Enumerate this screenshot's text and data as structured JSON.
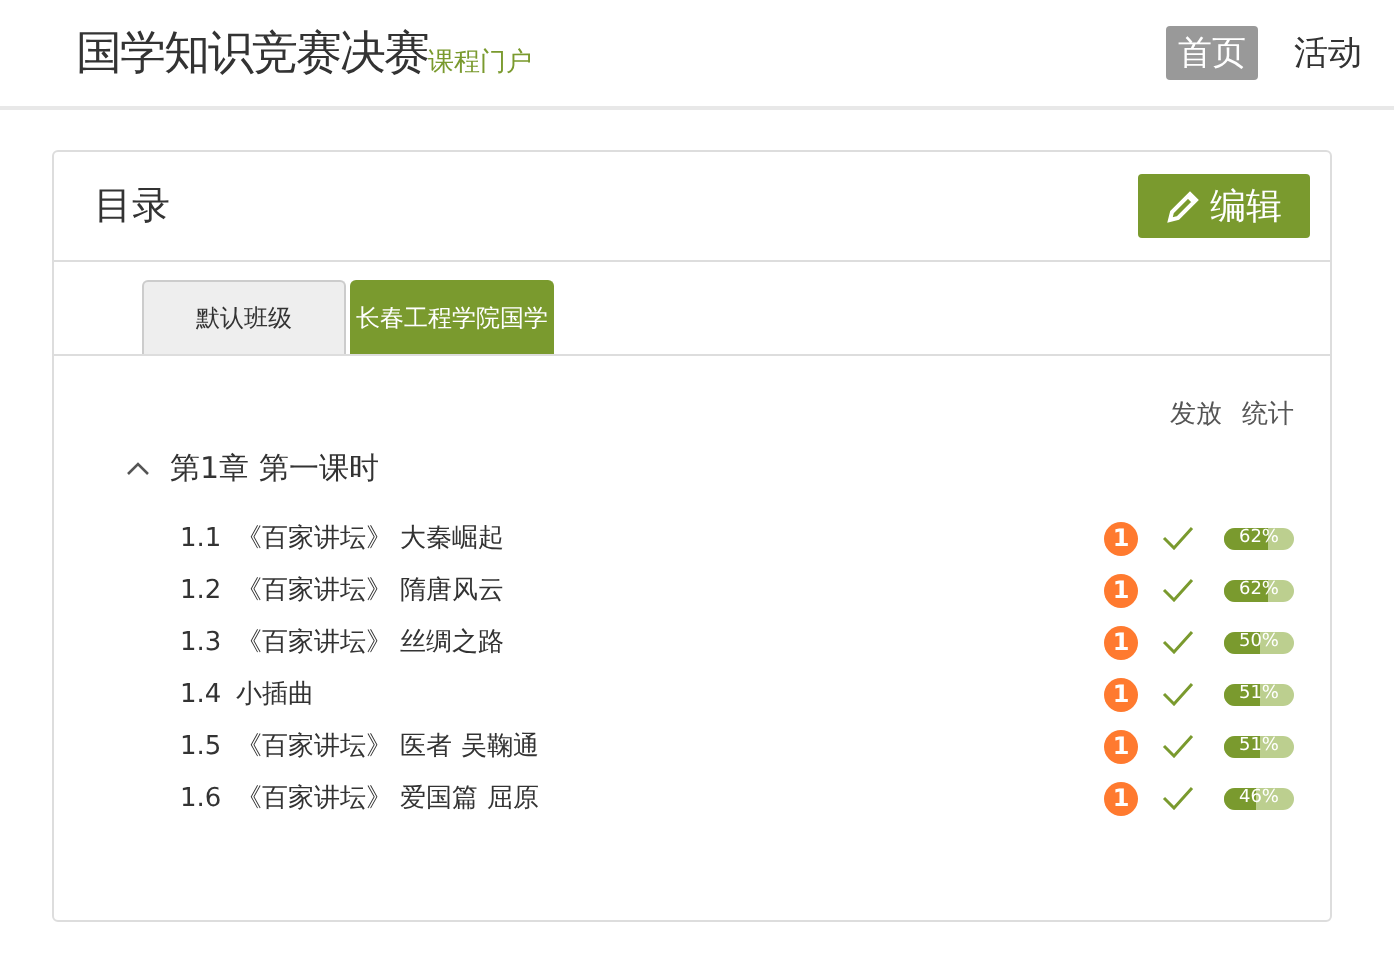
{
  "header": {
    "title": "国学知识竞赛决赛",
    "subtitle": "课程门户",
    "nav": [
      {
        "label": "首页",
        "selected": true
      },
      {
        "label": "活动",
        "selected": false
      }
    ]
  },
  "card": {
    "title": "目录",
    "edit_button": "编辑",
    "tabs": [
      {
        "label": "默认班级",
        "selected": false
      },
      {
        "label": "长春工程学院国学",
        "selected": true
      }
    ],
    "columns": [
      "发放",
      "统计"
    ],
    "chapter": {
      "expanded": true,
      "title": "第1章 第一课时",
      "lessons": [
        {
          "number": "1.1",
          "title": "《百家讲坛》 大秦崛起",
          "badge": "1",
          "released": true,
          "level": 0.62,
          "reading": "62%"
        },
        {
          "number": "1.2",
          "title": "《百家讲坛》 隋唐风云",
          "badge": "1",
          "released": true,
          "level": 0.62,
          "reading": "62%"
        },
        {
          "number": "1.3",
          "title": "《百家讲坛》 丝绸之路",
          "badge": "1",
          "released": true,
          "level": 0.5,
          "reading": "50%"
        },
        {
          "number": "1.4",
          "title": "小插曲",
          "badge": "1",
          "released": true,
          "level": 0.51,
          "reading": "51%"
        },
        {
          "number": "1.5",
          "title": "《百家讲坛》 医者 吴鞠通",
          "badge": "1",
          "released": true,
          "level": 0.51,
          "reading": "51%"
        },
        {
          "number": "1.6",
          "title": "《百家讲坛》 爱国篇 屈原",
          "badge": "1",
          "released": true,
          "level": 0.46,
          "reading": "46%"
        }
      ]
    }
  }
}
